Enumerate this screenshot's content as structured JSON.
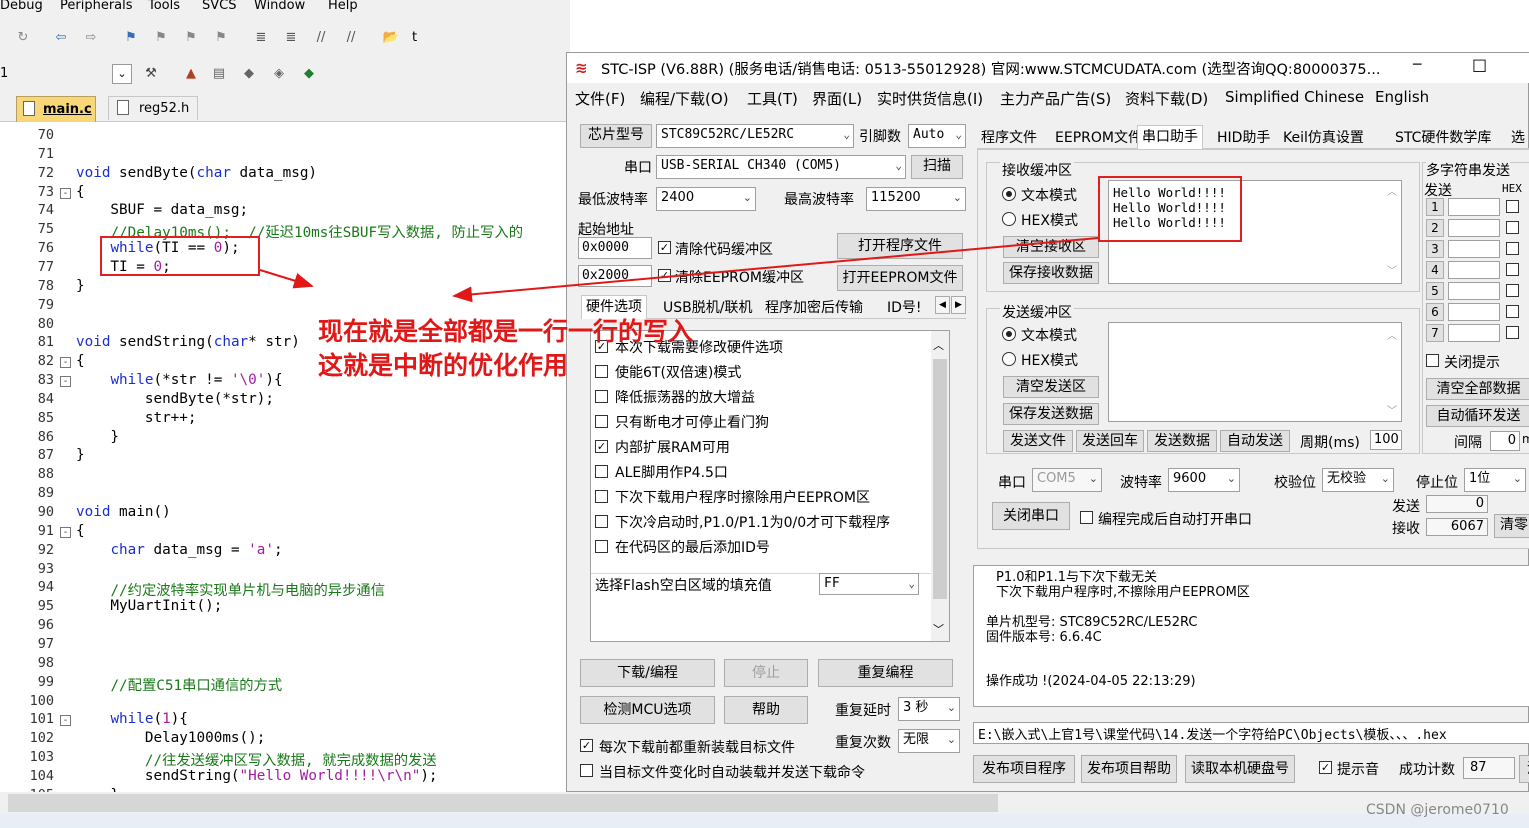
{
  "ide": {
    "menu": [
      "Debug",
      "Peripherals",
      "Tools",
      "SVCS",
      "Window",
      "Help"
    ],
    "toolbar_text": "t",
    "target_value": "1",
    "tabs": [
      "main.c",
      "reg52.h"
    ],
    "lines": [
      {
        "n": "70",
        "t": "",
        "fold": ""
      },
      {
        "n": "71",
        "t": "",
        "fold": ""
      },
      {
        "n": "72",
        "t": "void sendByte(char data_msg)",
        "fold": ""
      },
      {
        "n": "73",
        "t": "{",
        "fold": "-"
      },
      {
        "n": "74",
        "t": "    SBUF = data_msg;",
        "fold": ""
      },
      {
        "n": "75",
        "t": "    //Delay10ms();  //延迟10ms往SBUF写入数据, 防止写入的",
        "fold": ""
      },
      {
        "n": "76",
        "t": "    while(TI == 0);",
        "fold": ""
      },
      {
        "n": "77",
        "t": "    TI = 0;",
        "fold": ""
      },
      {
        "n": "78",
        "t": "}",
        "fold": ""
      },
      {
        "n": "79",
        "t": "",
        "fold": ""
      },
      {
        "n": "80",
        "t": "",
        "fold": ""
      },
      {
        "n": "81",
        "t": "void sendString(char* str)",
        "fold": ""
      },
      {
        "n": "82",
        "t": "{",
        "fold": "-"
      },
      {
        "n": "83",
        "t": "    while(*str != '\\0'){",
        "fold": "-"
      },
      {
        "n": "84",
        "t": "        sendByte(*str);",
        "fold": ""
      },
      {
        "n": "85",
        "t": "        str++;",
        "fold": ""
      },
      {
        "n": "86",
        "t": "    }",
        "fold": ""
      },
      {
        "n": "87",
        "t": "}",
        "fold": ""
      },
      {
        "n": "88",
        "t": "",
        "fold": ""
      },
      {
        "n": "89",
        "t": "",
        "fold": ""
      },
      {
        "n": "90",
        "t": "void main()",
        "fold": ""
      },
      {
        "n": "91",
        "t": "{",
        "fold": "-"
      },
      {
        "n": "92",
        "t": "    char data_msg = 'a';",
        "fold": ""
      },
      {
        "n": "93",
        "t": "",
        "fold": ""
      },
      {
        "n": "94",
        "t": "    //约定波特率实现单片机与电脑的异步通信",
        "fold": ""
      },
      {
        "n": "95",
        "t": "    MyUartInit();",
        "fold": ""
      },
      {
        "n": "96",
        "t": "",
        "fold": ""
      },
      {
        "n": "97",
        "t": "",
        "fold": ""
      },
      {
        "n": "98",
        "t": "",
        "fold": ""
      },
      {
        "n": "99",
        "t": "    //配置C51串口通信的方式",
        "fold": ""
      },
      {
        "n": "100",
        "t": "",
        "fold": ""
      },
      {
        "n": "101",
        "t": "    while(1){",
        "fold": "-"
      },
      {
        "n": "102",
        "t": "        Delay1000ms();",
        "fold": ""
      },
      {
        "n": "103",
        "t": "        //往发送缓冲区写入数据, 就完成数据的发送",
        "fold": ""
      },
      {
        "n": "104",
        "t": "        sendString(\"Hello World!!!!\\r\\n\");",
        "fold": ""
      },
      {
        "n": "105",
        "t": "    }",
        "fold": ""
      }
    ]
  },
  "annotation": {
    "line1": "现在就是全部都是一行一行的写入",
    "line2": "这就是中断的优化作用",
    "color": "#e01818"
  },
  "stc": {
    "title": "STC-ISP (V6.88R) (服务电话/销售电话: 0513-55012928) 官网:www.STCMCUDATA.com  (选型咨询QQ:80000375...",
    "minimize": "─",
    "maximize": "□",
    "menu": [
      "文件(F)",
      "编程/下载(O)",
      "工具(T)",
      "界面(L)",
      "实时供货信息(I)",
      "主力产品广告(S)",
      "资料下载(D)",
      "Simplified Chinese",
      "English"
    ],
    "left": {
      "chip_label": "芯片型号",
      "chip_value": "STC89C52RC/LE52RC",
      "pin_label": "引脚数",
      "pin_value": "Auto",
      "port_label": "串口",
      "port_value": "USB-SERIAL CH340 (COM5)",
      "scan": "扫描",
      "minbaud_label": "最低波特率",
      "minbaud_value": "2400",
      "maxbaud_label": "最高波特率",
      "maxbaud_value": "115200",
      "start_label": "起始地址",
      "addr1": "0x0000",
      "clear_code": "清除代码缓冲区",
      "open_prog": "打开程序文件",
      "addr2": "0x2000",
      "clear_eeprom": "清除EEPROM缓冲区",
      "open_eeprom": "打开EEPROM文件",
      "tabs": [
        "硬件选项",
        "USB脱机/联机",
        "程序加密后传输",
        "ID号!"
      ],
      "options": [
        {
          "label": "本次下载需要修改硬件选项",
          "checked": true
        },
        {
          "label": "使能6T(双倍速)模式",
          "checked": false
        },
        {
          "label": "降低振荡器的放大增益",
          "checked": false
        },
        {
          "label": "只有断电才可停止看门狗",
          "checked": false
        },
        {
          "label": "内部扩展RAM可用",
          "checked": true
        },
        {
          "label": "ALE脚用作P4.5口",
          "checked": false
        },
        {
          "label": "下次下载用户程序时擦除用户EEPROM区",
          "checked": false
        },
        {
          "label": "下次冷启动时,P1.0/P1.1为0/0才可下载程序",
          "checked": false
        },
        {
          "label": "在代码区的最后添加ID号",
          "checked": false
        }
      ],
      "fill_label": "选择Flash空白区域的填充值",
      "fill_value": "FF",
      "download": "下载/编程",
      "stop": "停止",
      "reprogram": "重复编程",
      "detect": "检测MCU选项",
      "help": "帮助",
      "delay_label": "重复延时",
      "delay_value": "3 秒",
      "reload": "每次下载前都重新装载目标文件",
      "repeat_label": "重复次数",
      "repeat_value": "无限",
      "autoload": "当目标文件变化时自动装载并发送下载命令"
    },
    "right": {
      "tabs": [
        "程序文件",
        "EEPROM文件",
        "串口助手",
        "HID助手",
        "Keil仿真设置",
        "STC硬件数学库",
        "选"
      ],
      "recv_title": "接收缓冲区",
      "text_mode": "文本模式",
      "hex_mode": "HEX模式",
      "clear_recv": "清空接收区",
      "save_recv": "保存接收数据",
      "recv_lines": [
        "Hello World!!!!",
        "Hello World!!!!",
        "Hello World!!!!"
      ],
      "send_title": "发送缓冲区",
      "clear_send": "清空发送区",
      "save_send": "保存发送数据",
      "send_file": "发送文件",
      "send_enter": "发送回车",
      "send_data": "发送数据",
      "auto_send": "自动发送",
      "period_label": "周期(ms)",
      "period_value": "100",
      "multi_title": "多字符串发送",
      "send_col": "发送",
      "hex_col": "HEX",
      "rows": [
        "1",
        "2",
        "3",
        "4",
        "5",
        "6",
        "7"
      ],
      "close_hint": "关闭提示",
      "clear_all": "清空全部数据",
      "auto_loop": "自动循环发送",
      "interval_label": "间隔",
      "interval_value": "0",
      "interval_unit": "m",
      "port_label": "串口",
      "port_value": "COM5",
      "baud_label": "波特率",
      "baud_value": "9600",
      "parity_label": "校验位",
      "parity_value": "无校验",
      "stop_label": "停止位",
      "stop_value": "1位",
      "close_port": "关闭串口",
      "auto_open": "编程完成后自动打开串口",
      "sent_label": "发送",
      "sent_value": "0",
      "recv_label": "接收",
      "recv_value": "6067",
      "clear_btn": "清零"
    },
    "log": [
      "P1.0和P1.1与下次下载无关",
      "下次下载用户程序时,不擦除用户EEPROM区",
      "",
      "单片机型号: STC89C52RC/LE52RC",
      "固件版本号: 6.6.4C",
      "",
      "操作成功 !(2024-04-05 22:13:29)"
    ],
    "filepath": "E:\\嵌入式\\上官1号\\课堂代码\\14.发送一个字符给PC\\Objects\\模板、、、.hex",
    "bottom": {
      "publish_prog": "发布项目程序",
      "publish_help": "发布项目帮助",
      "read_disk": "读取本机硬盘号",
      "beep": "提示音",
      "count_label": "成功计数",
      "count_value": "87",
      "clear": "清"
    }
  },
  "watermark": "CSDN @jerome0710"
}
